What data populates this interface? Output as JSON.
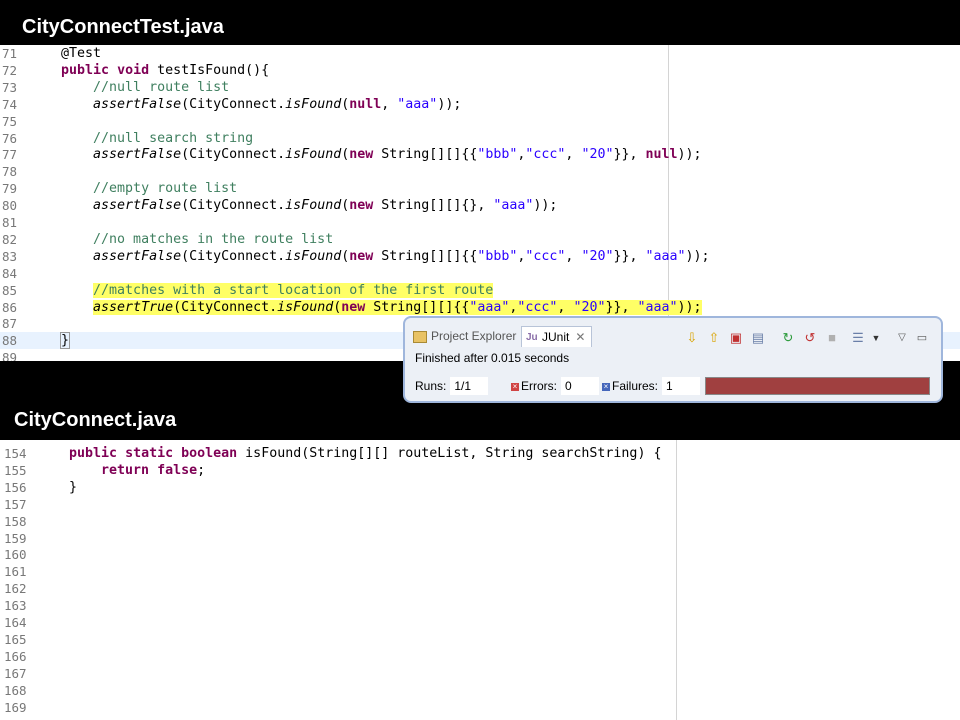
{
  "titles": {
    "test_file": "CityConnectTest.java",
    "main_file": "CityConnect.java"
  },
  "editor1": {
    "lines": [
      {
        "n": "71",
        "code": "    @Test"
      },
      {
        "n": "72",
        "code": "    public void testIsFound(){"
      },
      {
        "n": "73",
        "code": "        //null route list"
      },
      {
        "n": "74",
        "code": "        assertFalse(CityConnect.isFound(null, \"aaa\"));"
      },
      {
        "n": "75",
        "code": ""
      },
      {
        "n": "76",
        "code": "        //null search string"
      },
      {
        "n": "77",
        "code": "        assertFalse(CityConnect.isFound(new String[][]{{\"bbb\",\"ccc\", \"20\"}}, null));"
      },
      {
        "n": "78",
        "code": ""
      },
      {
        "n": "79",
        "code": "        //empty route list"
      },
      {
        "n": "80",
        "code": "        assertFalse(CityConnect.isFound(new String[][]{}, \"aaa\"));"
      },
      {
        "n": "81",
        "code": ""
      },
      {
        "n": "82",
        "code": "        //no matches in the route list"
      },
      {
        "n": "83",
        "code": "        assertFalse(CityConnect.isFound(new String[][]{{\"bbb\",\"ccc\", \"20\"}}, \"aaa\"));"
      },
      {
        "n": "84",
        "code": ""
      },
      {
        "n": "85",
        "code": "        //matches with a start location of the first route"
      },
      {
        "n": "86",
        "code": "        assertTrue(CityConnect.isFound(new String[][]{{\"aaa\",\"ccc\", \"20\"}}, \"aaa\"));"
      },
      {
        "n": "87",
        "code": ""
      },
      {
        "n": "88",
        "code": "    }"
      },
      {
        "n": "89",
        "code": ""
      }
    ]
  },
  "editor2": {
    "lines": [
      {
        "n": "154",
        "code": "    public static boolean isFound(String[][] routeList, String searchString) {"
      },
      {
        "n": "155",
        "code": "        return false;"
      },
      {
        "n": "156",
        "code": "    }"
      },
      {
        "n": "157",
        "code": ""
      },
      {
        "n": "158",
        "code": ""
      },
      {
        "n": "159",
        "code": ""
      },
      {
        "n": "160",
        "code": ""
      },
      {
        "n": "161",
        "code": ""
      },
      {
        "n": "162",
        "code": ""
      },
      {
        "n": "163",
        "code": ""
      },
      {
        "n": "164",
        "code": ""
      },
      {
        "n": "165",
        "code": ""
      },
      {
        "n": "166",
        "code": ""
      },
      {
        "n": "167",
        "code": ""
      },
      {
        "n": "168",
        "code": ""
      },
      {
        "n": "169",
        "code": ""
      }
    ]
  },
  "junit": {
    "tab_project_explorer": "Project Explorer",
    "tab_junit": "JUnit",
    "finished": "Finished after 0.015 seconds",
    "runs_label": "Runs:",
    "runs_value": "1/1",
    "errors_label": "Errors:",
    "errors_value": "0",
    "failures_label": "Failures:",
    "failures_value": "1",
    "status_color": "#a04040"
  }
}
